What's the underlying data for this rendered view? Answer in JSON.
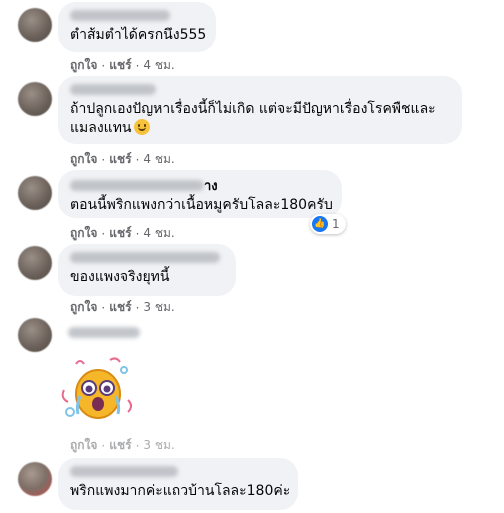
{
  "actions": {
    "like": "ถูกใจ",
    "dot": "·",
    "reply": "แชร์"
  },
  "comments": [
    {
      "text": "ตำส้มตำได้ครกนึง555",
      "time": "4 ชม."
    },
    {
      "text_line1": "ถ้าปลูกเองปัญหาเรื่องนี้ก็ไม่เกิด แต่จะมีปัญหาเรื่องโรคพืชและ",
      "text_line2": "แมลงแทน",
      "emoji_icon": "smiling-face-emoji",
      "time": "4 ชม."
    },
    {
      "name_tail": "าง",
      "text": "ตอนนี้พริกแพงกว่าเนื้อหมูครับโลละ180ครับ",
      "time": "4 ชม.",
      "reaction_count": "1",
      "reaction_icon": "like-icon"
    },
    {
      "text": "ของแพงจริงยุทนี้",
      "time": "3 ชม."
    },
    {
      "sticker_icon": "crying-cartoon-sticker",
      "time": "3 ชม."
    },
    {
      "text": "พริกแพงมากค่ะแถวบ้านโลละ180ค่ะ"
    }
  ],
  "colors": {
    "bubble": "#f0f2f5",
    "meta": "#65676b",
    "like_blue": "#1877f2"
  }
}
